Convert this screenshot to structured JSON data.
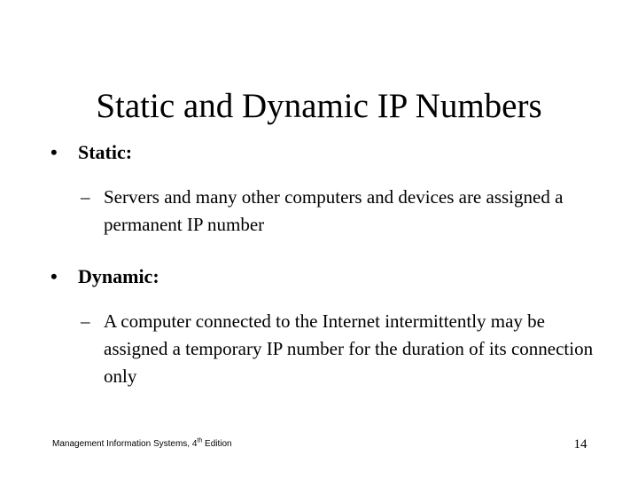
{
  "slide": {
    "title": "Static and Dynamic IP Numbers",
    "background_color": "#ffffff",
    "text_color": "#000000",
    "bullets": [
      {
        "level": 1,
        "marker": "•",
        "text": "Static:"
      },
      {
        "level": 2,
        "marker": "–",
        "text": "Servers and many other computers and devices are assigned a permanent IP number"
      },
      {
        "level": 1,
        "marker": "•",
        "text": "Dynamic:"
      },
      {
        "level": 2,
        "marker": "–",
        "text": "A computer connected to the Internet intermittently may be assigned a temporary IP number for the duration of its connection only"
      }
    ]
  },
  "footer": {
    "source_prefix": "Management Information Systems, 4",
    "source_superscript": "th",
    "source_suffix": " Edition",
    "page_number": "14"
  }
}
